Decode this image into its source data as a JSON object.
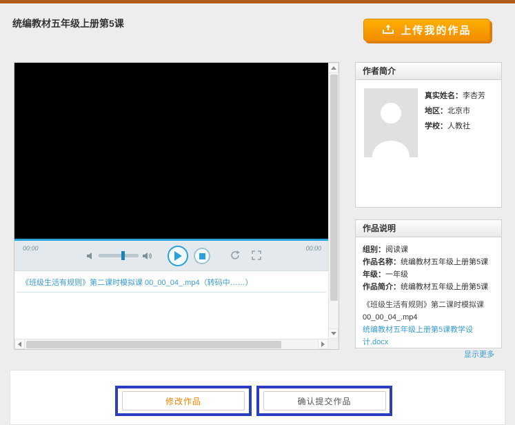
{
  "colors": {
    "accent_orange": "#f28c00",
    "link_blue": "#3a9cd0",
    "annotation_blue": "#2c3cc0",
    "player_blue": "#2ba0d9"
  },
  "header": {
    "title": "统编教材五年级上册第5课",
    "upload_button": "上传我的作品"
  },
  "player": {
    "time_current": "00:00",
    "time_total": "00:00",
    "playlist_item": "《班级生活有规则》第二课时模拟课 00_00_04_.mp4（转码中……）"
  },
  "author_panel": {
    "title": "作者简介",
    "fields": [
      {
        "label": "真实姓名：",
        "value": "李杏芳"
      },
      {
        "label": "地区：",
        "value": "北京市"
      },
      {
        "label": "学校：",
        "value": "人教社"
      }
    ]
  },
  "work_panel": {
    "title": "作品说明",
    "fields": [
      {
        "label": "组别：",
        "value": "阅读课"
      },
      {
        "label": "作品名称：",
        "value": "统编教材五年级上册第5课"
      },
      {
        "label": "年级：",
        "value": "一年级"
      },
      {
        "label": "作品简介：",
        "value": "统编教材五年级上册第5课"
      }
    ],
    "attachment_title": "《班级生活有规则》第二课时模拟课",
    "attachment_file": "00_00_04_.mp4",
    "attachment_doc": "统编教材五年级上册第5课教学设计.docx",
    "show_more": "显示更多"
  },
  "footer": {
    "modify_button": "修改作品",
    "submit_button": "确认提交作品"
  }
}
